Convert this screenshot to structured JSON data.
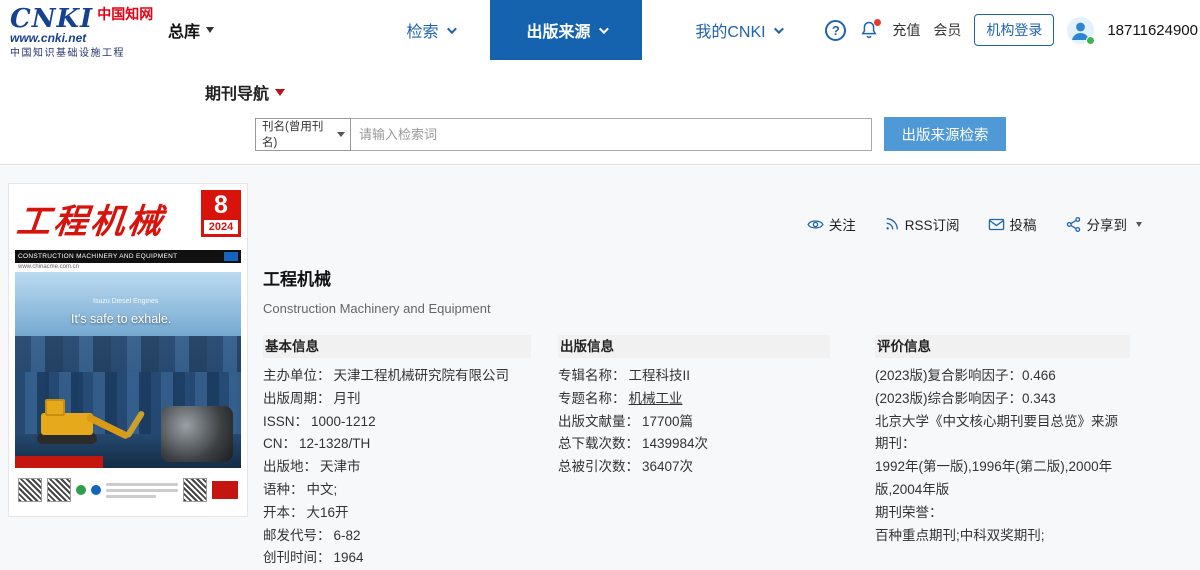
{
  "header": {
    "logo": {
      "brand": "CNKI",
      "brand_cn": "中国知网",
      "site": "www.cnki.net",
      "slogan": "中国知识基础设施工程"
    },
    "library_switch": "总库",
    "nav": [
      {
        "label": "检索"
      },
      {
        "label": "出版来源"
      },
      {
        "label": "我的CNKI"
      }
    ],
    "help": "?",
    "recharge": "充值",
    "member": "会员",
    "org_login": "机构登录",
    "phone": "18711624900"
  },
  "subheader": {
    "nav_title": "期刊导航",
    "filter_value": "刊名(曾用刊名)",
    "search_placeholder": "请输入检索词",
    "search_button": "出版来源检索"
  },
  "cover": {
    "title": "工程机械",
    "issue": "8",
    "year": "2024",
    "english": "CONSTRUCTION MACHINERY AND EQUIPMENT",
    "url": "www.chinacme.com.cn",
    "engine_brand": "Isuzu Diesel Engines",
    "tagline": "It's safe to exhale."
  },
  "journal": {
    "title": "工程机械",
    "subtitle": "Construction Machinery and Equipment",
    "actions": [
      {
        "label": "关注"
      },
      {
        "label": "RSS订阅"
      },
      {
        "label": "投稿"
      },
      {
        "label": "分享到"
      }
    ],
    "basic": {
      "title": "基本信息",
      "rows": [
        {
          "label": "主办单位：",
          "value": "天津工程机械研究院有限公司"
        },
        {
          "label": "出版周期：",
          "value": "月刊"
        },
        {
          "label": "ISSN：",
          "value": "1000-1212"
        },
        {
          "label": "CN：",
          "value": "12-1328/TH"
        },
        {
          "label": "出版地：",
          "value": "天津市"
        },
        {
          "label": "语种：",
          "value": "中文;"
        },
        {
          "label": "开本：",
          "value": "大16开"
        },
        {
          "label": "邮发代号：",
          "value": "6-82"
        },
        {
          "label": "创刊时间：",
          "value": "1964"
        }
      ]
    },
    "publish": {
      "title": "出版信息",
      "rows": [
        {
          "label": "专辑名称：",
          "value": "工程科技II"
        },
        {
          "label": "专题名称：",
          "value": "机械工业"
        },
        {
          "label": "出版文献量：",
          "value": "17700篇"
        },
        {
          "label": "总下载次数：",
          "value": "1439984次"
        },
        {
          "label": "总被引次数：",
          "value": "36407次"
        }
      ]
    },
    "evaluation": {
      "title": "评价信息",
      "lines": [
        "(2023版)复合影响因子：0.466",
        "(2023版)综合影响因子：0.343",
        "北京大学《中文核心期刊要目总览》来源期刊：",
        "1992年(第一版),1996年(第二版),2000年版,2004年版",
        "期刊荣誉：",
        "百种重点期刊;中科双奖期刊;"
      ]
    }
  }
}
